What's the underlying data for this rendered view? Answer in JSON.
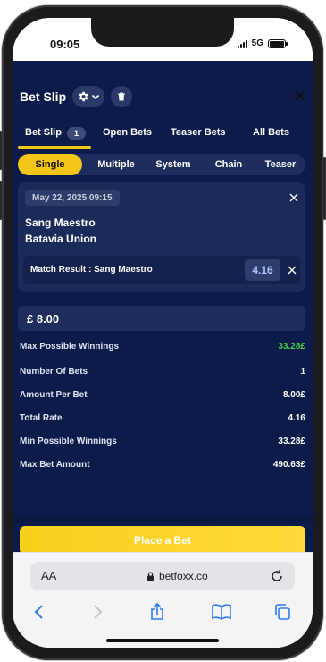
{
  "status": {
    "time": "09:05",
    "network": "5G"
  },
  "header": {
    "title": "Bet Slip"
  },
  "tabs": [
    {
      "label": "Bet Slip",
      "badge": "1"
    },
    {
      "label": "Open Bets"
    },
    {
      "label": "Teaser Bets"
    },
    {
      "label": "All Bets"
    }
  ],
  "bet_types": [
    "Single",
    "Multiple",
    "System",
    "Chain",
    "Teaser"
  ],
  "bet": {
    "date": "May 22, 2025 09:15",
    "home": "Sang Maestro",
    "away": "Batavia Union",
    "selection": "Match Result : Sang Maestro",
    "odds": "4.16"
  },
  "stake": "£ 8.00",
  "summary": [
    {
      "label": "Max Possible Winnings",
      "value": "33.28£"
    },
    {
      "label": "Number Of Bets",
      "value": "1"
    },
    {
      "label": "Amount Per Bet",
      "value": "8.00£"
    },
    {
      "label": "Total Rate",
      "value": "4.16"
    },
    {
      "label": "Min Possible Winnings",
      "value": "33.28£"
    },
    {
      "label": "Max Bet Amount",
      "value": "490.63£"
    }
  ],
  "place_label": "Place a Bet",
  "browser": {
    "aa": "AA",
    "url": "betfoxx.co"
  },
  "colors": {
    "app_bg": "#0c1c4a",
    "accent": "#f5c518",
    "positive": "#3ecf4a"
  }
}
